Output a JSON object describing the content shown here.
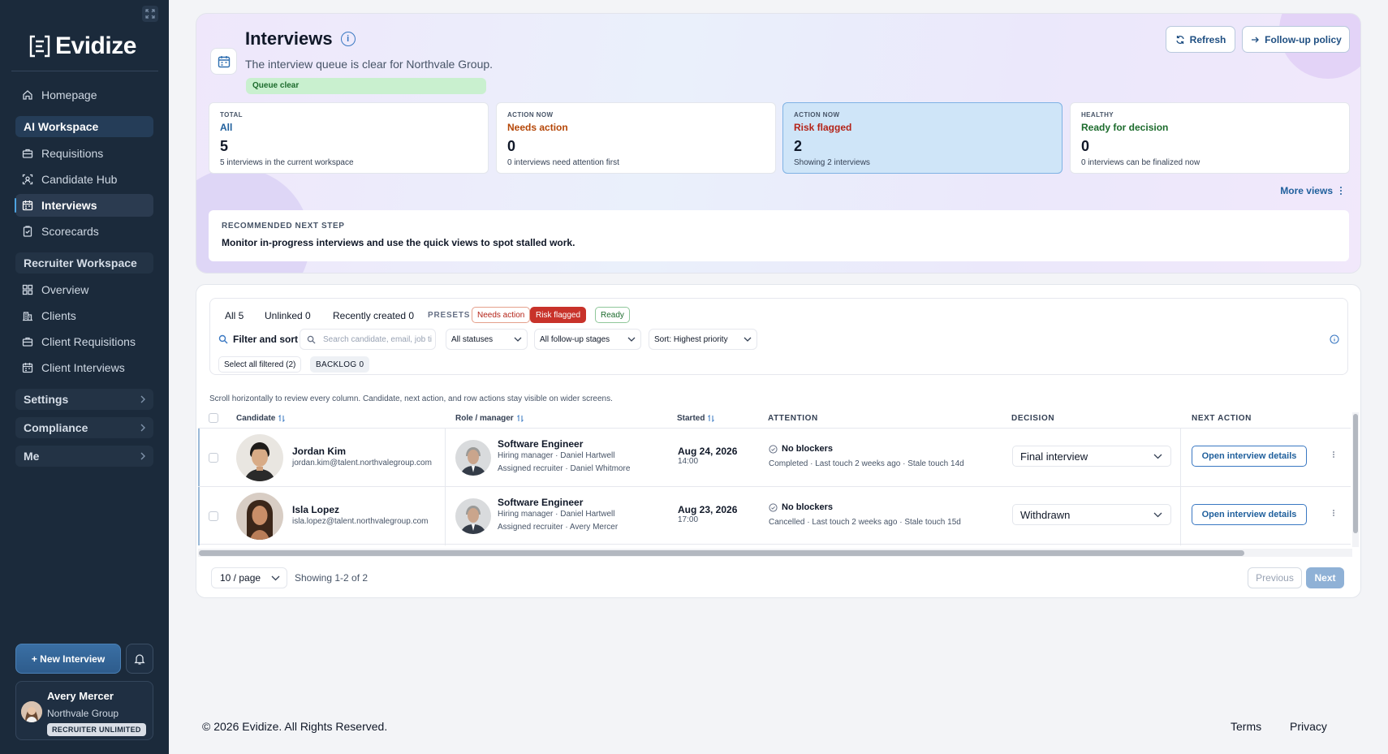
{
  "brand": {
    "name": "Evidize"
  },
  "sidebar": {
    "items": [
      {
        "label": "Homepage"
      },
      {
        "label": "AI Workspace"
      },
      {
        "label": "Requisitions"
      },
      {
        "label": "Candidate Hub"
      },
      {
        "label": "Interviews"
      },
      {
        "label": "Scorecards"
      },
      {
        "label": "Recruiter Workspace"
      },
      {
        "label": "Overview"
      },
      {
        "label": "Clients"
      },
      {
        "label": "Client Requisitions"
      },
      {
        "label": "Client Interviews"
      }
    ],
    "groups": [
      {
        "label": "Settings"
      },
      {
        "label": "Compliance"
      },
      {
        "label": "Me"
      }
    ],
    "new_interview_label": "+ New Interview",
    "user": {
      "name": "Avery Mercer",
      "org": "Northvale Group",
      "badge": "RECRUITER UNLIMITED"
    }
  },
  "header": {
    "title": "Interviews",
    "subtitle": "The interview queue is clear for Northvale Group.",
    "status": "Queue clear",
    "refresh_label": "Refresh",
    "policy_label": "Follow-up policy"
  },
  "stats": [
    {
      "kicker": "TOTAL",
      "label": "All",
      "value": "5",
      "desc": "5 interviews in the current workspace",
      "color": "#1f5f9c"
    },
    {
      "kicker": "ACTION NOW",
      "label": "Needs action",
      "value": "0",
      "desc": "0 interviews need attention first",
      "color": "#b54708"
    },
    {
      "kicker": "ACTION NOW",
      "label": "Risk flagged",
      "value": "2",
      "desc": "Showing 2 interviews",
      "color": "#b42318"
    },
    {
      "kicker": "HEALTHY",
      "label": "Ready for decision",
      "value": "0",
      "desc": "0 interviews can be finalized now",
      "color": "#1c6b2c"
    }
  ],
  "more_views": "More views",
  "recommendation": {
    "kicker": "RECOMMENDED NEXT STEP",
    "text": "Monitor in-progress interviews and use the quick views to spot stalled work."
  },
  "filters": {
    "tabs": [
      "All 5",
      "Unlinked 0",
      "Recently created 0"
    ],
    "presets_label": "PRESETS",
    "presets": [
      "Needs action",
      "Risk flagged",
      "Ready"
    ],
    "filter_sort_label": "Filter and sort",
    "search_placeholder": "Search candidate, email, job ti",
    "status_select": "All statuses",
    "stage_select": "All follow-up stages",
    "sort_select": "Sort: Highest priority",
    "select_all": "Select all filtered (2)",
    "backlog": "BACKLOG 0"
  },
  "table": {
    "note": "Scroll horizontally to review every column. Candidate, next action, and row actions stay visible on wider screens.",
    "columns": [
      "Candidate",
      "Role / manager",
      "Started",
      "ATTENTION",
      "DECISION",
      "NEXT ACTION"
    ],
    "rows": [
      {
        "name": "Jordan Kim",
        "email": "jordan.kim@talent.northvalegroup.com",
        "role": "Software Engineer",
        "manager": "Hiring manager · Daniel Hartwell",
        "recruiter": "Assigned recruiter · Daniel Whitmore",
        "date": "Aug 24, 2026",
        "time": "14:00",
        "attention": "No blockers",
        "attention_detail": "Completed · Last touch 2 weeks ago · Stale touch 14d",
        "decision": "Final interview",
        "action": "Open interview details"
      },
      {
        "name": "Isla Lopez",
        "email": "isla.lopez@talent.northvalegroup.com",
        "role": "Software Engineer",
        "manager": "Hiring manager · Daniel Hartwell",
        "recruiter": "Assigned recruiter · Avery Mercer",
        "date": "Aug 23, 2026",
        "time": "17:00",
        "attention": "No blockers",
        "attention_detail": "Cancelled · Last touch 2 weeks ago · Stale touch 15d",
        "decision": "Withdrawn",
        "action": "Open interview details"
      }
    ]
  },
  "pagination": {
    "per_page": "10 / page",
    "showing": "Showing 1-2 of 2",
    "previous": "Previous",
    "next": "Next"
  },
  "footer": {
    "copyright": "© 2026  Evidize. All Rights Reserved.",
    "terms": "Terms",
    "privacy": "Privacy"
  }
}
